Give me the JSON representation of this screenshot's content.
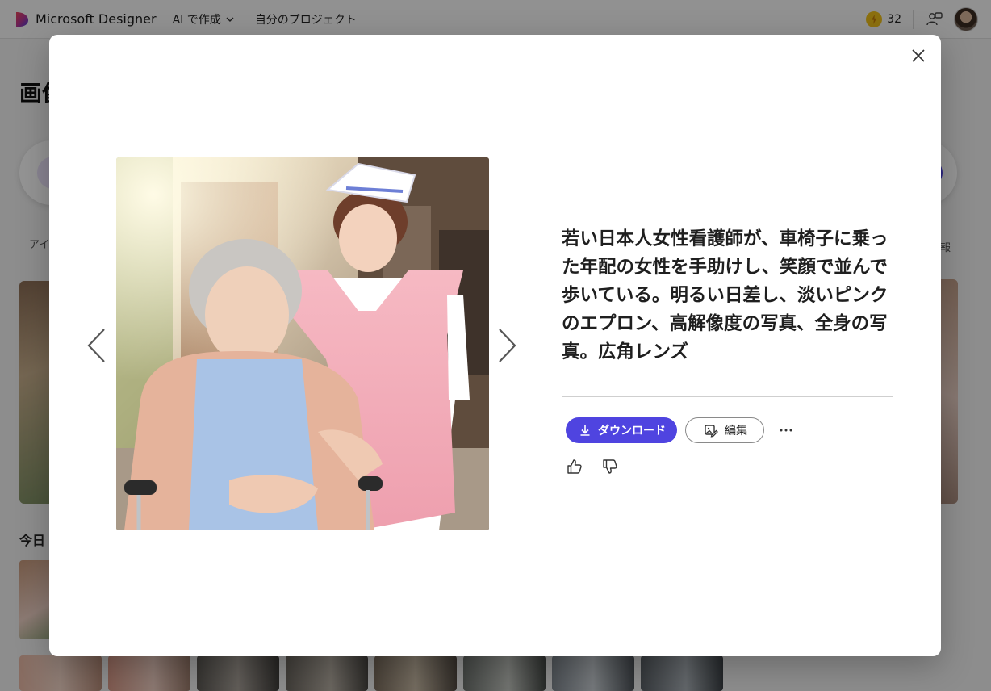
{
  "app": {
    "title": "Microsoft Designer",
    "nav": [
      {
        "label": "AI で作成"
      },
      {
        "label": "自分のプロジェクト"
      }
    ],
    "credits": "32"
  },
  "background": {
    "heading": "画像",
    "filter_left": "アイ",
    "filter_right": "情報",
    "section_today": "今日"
  },
  "modal": {
    "prompt": "若い日本人女性看護師が、車椅子に乗った年配の女性を手助けし、笑顔で並んで歩いている。明るい日差し、淡いピンクのエプロン、高解像度の写真、全身の写真。広角レンズ",
    "download_label": "ダウンロード",
    "edit_label": "編集",
    "icons": [
      "close-icon",
      "chevron-left-icon",
      "chevron-right-icon",
      "download-icon",
      "edit-image-icon",
      "more-icon",
      "thumbs-up-icon",
      "thumbs-down-icon"
    ]
  },
  "colors": {
    "accent": "#4f44e0",
    "overlay": "rgba(0,0,0,0.42)"
  }
}
